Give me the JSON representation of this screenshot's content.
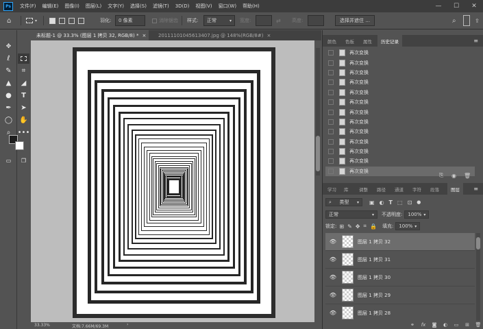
{
  "app": {
    "logo": "Ps",
    "menus": [
      "文件(F)",
      "编辑(E)",
      "图像(I)",
      "图层(L)",
      "文字(Y)",
      "选择(S)",
      "滤镜(T)",
      "3D(D)",
      "视图(V)",
      "窗口(W)",
      "帮助(H)"
    ],
    "window_controls": {
      "minimize": "—",
      "maximize": "☐",
      "close": "✕"
    }
  },
  "options": {
    "feather_label": "羽化:",
    "feather_value": "0 像素",
    "antialias_label": "消除锯齿",
    "style_label": "样式:",
    "style_value": "正常",
    "width_label": "宽度:",
    "height_label": "高度:",
    "select_mask_button": "选择并遮住 ..."
  },
  "documents": {
    "tabs": [
      {
        "label": "未标题-1 @ 33.3% (图层 1 拷贝 32, RGB/8) *",
        "close": "×"
      },
      {
        "label": "20111101045613407.jpg @ 148%(RGB/8#)",
        "close": "×"
      }
    ]
  },
  "status": {
    "zoom": "33.33%",
    "doc_info": "文档:7.66M/69.3M",
    "arrow": "›"
  },
  "history_panel": {
    "tabs": [
      "颜色",
      "色板",
      "属性",
      "历史记录"
    ],
    "active_tab": 3,
    "items": [
      "再次变换",
      "再次变换",
      "再次变换",
      "再次变换",
      "再次变换",
      "再次变换",
      "再次变换",
      "再次变换",
      "再次变换",
      "再次变换",
      "再次变换",
      "再次变换",
      "再次变换"
    ],
    "selected_index": 12
  },
  "layers_panel": {
    "tabs": [
      "学习",
      "库",
      "调整",
      "路径",
      "通道",
      "字符",
      "段落",
      "图层"
    ],
    "active_tab": 7,
    "filter_label": "类型",
    "blend_mode": "正常",
    "opacity_label": "不透明度:",
    "opacity_value": "100%",
    "lock_label": "锁定:",
    "fill_label": "填充:",
    "fill_value": "100%",
    "layers": [
      "图层 1 拷贝 32",
      "图层 1 拷贝 31",
      "图层 1 拷贝 30",
      "图层 1 拷贝 29",
      "图层 1 拷贝 28"
    ],
    "selected_index": 0
  },
  "canvas": {
    "pattern": "concentric-rectangles",
    "frame_count": 32,
    "frame_color": "#262626",
    "canvas_bg": "#bdbdbd"
  }
}
